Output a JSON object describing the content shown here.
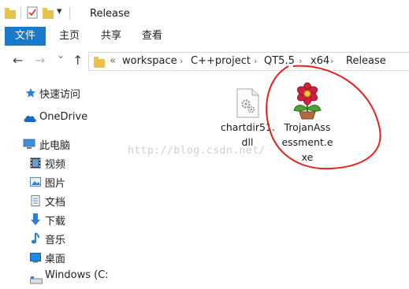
{
  "window": {
    "title": "Release"
  },
  "quick_access_toolbar": {
    "dropdown": "▾"
  },
  "ribbon": {
    "tabs": [
      {
        "label": "文件",
        "active": true
      },
      {
        "label": "主页"
      },
      {
        "label": "共享"
      },
      {
        "label": "查看"
      }
    ]
  },
  "navigation": {
    "back": "←",
    "forward": "→",
    "recent": "⌄",
    "up": "↑"
  },
  "address_bar": {
    "overflow": "«",
    "crumbs": [
      "workspace",
      "C++project",
      "QT5.5",
      "x64",
      "Release"
    ],
    "separator": "›"
  },
  "sidebar": {
    "items": [
      {
        "label": "快速访问",
        "icon": "star-icon"
      },
      {
        "label": "OneDrive",
        "icon": "cloud-icon"
      },
      {
        "label": "此电脑",
        "icon": "computer-icon"
      },
      {
        "label": "视频",
        "icon": "video-icon"
      },
      {
        "label": "图片",
        "icon": "picture-icon"
      },
      {
        "label": "文档",
        "icon": "document-icon"
      },
      {
        "label": "下载",
        "icon": "download-icon"
      },
      {
        "label": "音乐",
        "icon": "music-icon"
      },
      {
        "label": "桌面",
        "icon": "desktop-icon"
      },
      {
        "label": "Windows (C:)",
        "icon": "drive-icon"
      }
    ]
  },
  "files": [
    {
      "name_lines": [
        "chartdir51.",
        "dll"
      ],
      "icon": "dll-file-icon"
    },
    {
      "name_lines": [
        "TrojanAss",
        "essment.e",
        "xe"
      ],
      "icon": "flower-exe-icon"
    }
  ],
  "watermark": "http://blog.csdn.net/",
  "colors": {
    "accent": "#1979ca",
    "folder": "#e8c04c",
    "annotation": "#e8201c"
  }
}
